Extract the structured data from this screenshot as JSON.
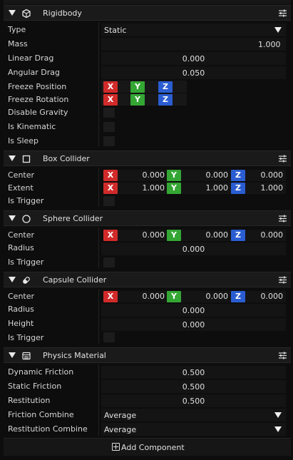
{
  "rigidbody": {
    "title": "Rigidbody",
    "type_label": "Type",
    "type_value": "Static",
    "mass_label": "Mass",
    "mass_value": "1.000",
    "linear_drag_label": "Linear Drag",
    "linear_drag_value": "0.000",
    "angular_drag_label": "Angular Drag",
    "angular_drag_value": "0.050",
    "freeze_position_label": "Freeze Position",
    "freeze_rotation_label": "Freeze Rotation",
    "disable_gravity_label": "Disable Gravity",
    "is_kinematic_label": "Is Kinematic",
    "is_sleep_label": "Is Sleep"
  },
  "box_collider": {
    "title": "Box Collider",
    "center_label": "Center",
    "center": [
      "0.000",
      "0.000",
      "0.000"
    ],
    "extent_label": "Extent",
    "extent": [
      "1.000",
      "1.000",
      "1.000"
    ],
    "is_trigger_label": "Is Trigger"
  },
  "sphere_collider": {
    "title": "Sphere Collider",
    "center_label": "Center",
    "center": [
      "0.000",
      "0.000",
      "0.000"
    ],
    "radius_label": "Radius",
    "radius_value": "0.000",
    "is_trigger_label": "Is Trigger"
  },
  "capsule_collider": {
    "title": "Capsule Collider",
    "center_label": "Center",
    "center": [
      "0.000",
      "0.000",
      "0.000"
    ],
    "radius_label": "Radius",
    "radius_value": "0.000",
    "height_label": "Height",
    "height_value": "0.000",
    "is_trigger_label": "Is Trigger"
  },
  "physics_material": {
    "title": "Physics Material",
    "dynamic_friction_label": "Dynamic Friction",
    "dynamic_friction_value": "0.500",
    "static_friction_label": "Static Friction",
    "static_friction_value": "0.500",
    "restitution_label": "Restitution",
    "restitution_value": "0.500",
    "friction_combine_label": "Friction Combine",
    "friction_combine_value": "Average",
    "restitution_combine_label": "Restitution Combine",
    "restitution_combine_value": "Average"
  },
  "axes": {
    "x": "X",
    "y": "Y",
    "z": "Z"
  },
  "add_component_label": "Add Component",
  "colors": {
    "axis_x": "#d12a2a",
    "axis_y": "#34a634",
    "axis_z": "#2a5dd1"
  },
  "icons": {
    "rigidbody": "cube-icon",
    "box_collider": "square-icon",
    "sphere_collider": "circle-icon",
    "capsule_collider": "capsule-icon",
    "physics_material": "material-icon",
    "settings": "settings-sliders-icon",
    "collapse": "triangle-down-icon",
    "add": "plus-box-icon"
  }
}
